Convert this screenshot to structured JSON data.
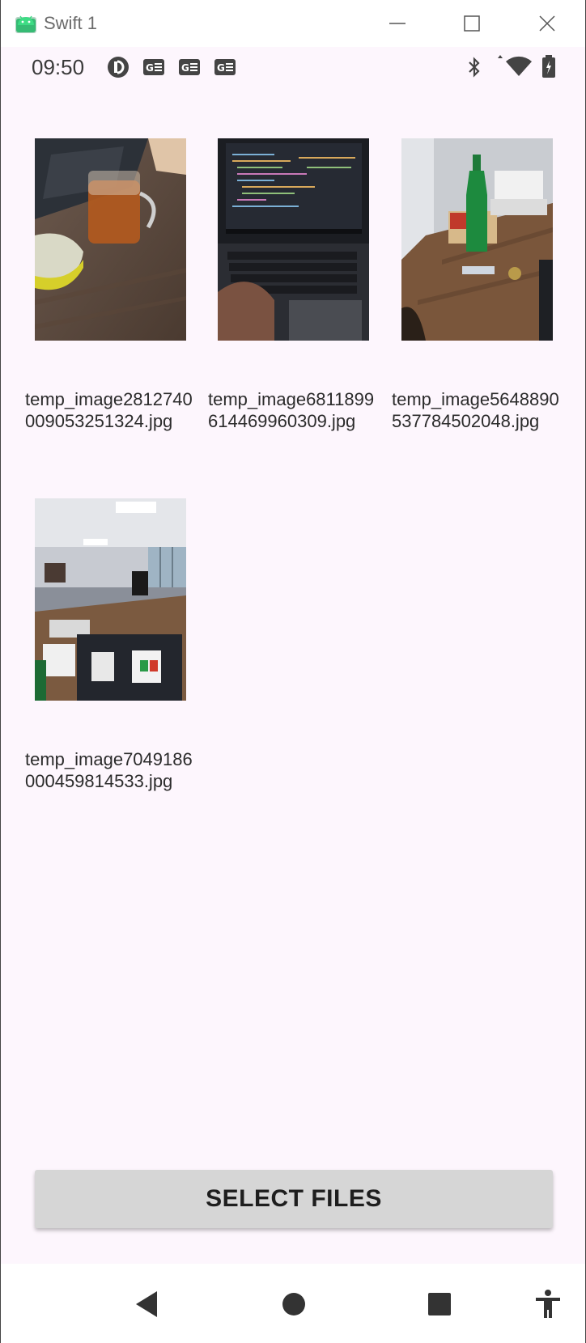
{
  "window": {
    "title": "Swift 1",
    "accent": "#3ddc84"
  },
  "status_bar": {
    "time": "09:50",
    "icons": [
      "pocket-casts-icon",
      "game-icon",
      "game-icon",
      "game-icon",
      "bluetooth-icon",
      "wifi-icon",
      "battery-charging-icon"
    ]
  },
  "files": [
    {
      "name": "temp_image2812740009053251324.jpg",
      "thumbnail": "tea-glass-photo"
    },
    {
      "name": "temp_image6811899614469960309.jpg",
      "thumbnail": "laptop-code-photo"
    },
    {
      "name": "temp_image5648890537784502048.jpg",
      "thumbnail": "desk-bottle-photo"
    },
    {
      "name": "temp_image7049186000459814533.jpg",
      "thumbnail": "office-room-photo"
    }
  ],
  "actions": {
    "select_files_label": "SELECT FILES"
  },
  "nav": {
    "items": [
      "back-icon",
      "home-icon",
      "recents-icon",
      "accessibility-icon"
    ]
  }
}
